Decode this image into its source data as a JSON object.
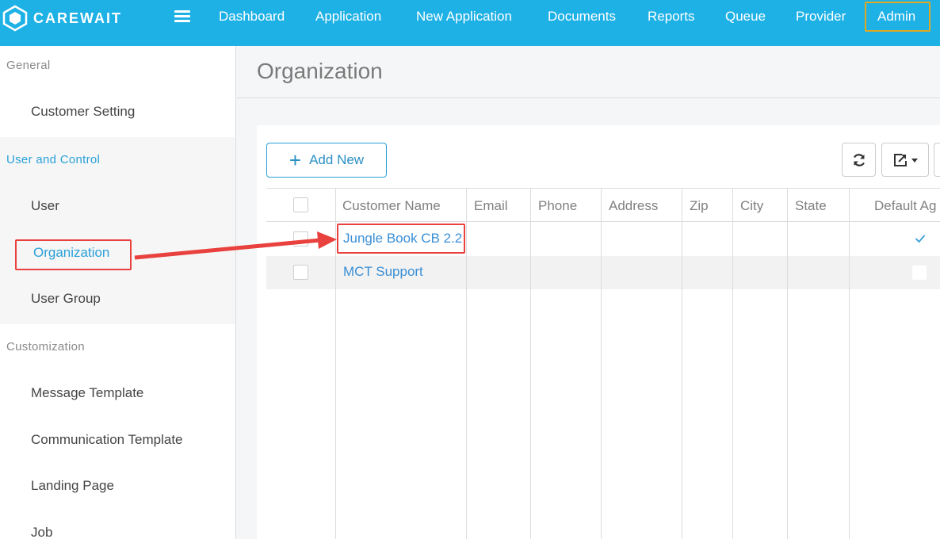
{
  "app": {
    "logo_text": "CAREWAIT"
  },
  "nav": {
    "items": [
      {
        "label": "Dashboard"
      },
      {
        "label": "Application"
      },
      {
        "label": "New Application"
      },
      {
        "label": "Documents"
      },
      {
        "label": "Reports"
      },
      {
        "label": "Queue"
      },
      {
        "label": "Provider"
      },
      {
        "label": "Admin"
      }
    ]
  },
  "sidebar": {
    "groups": [
      {
        "title": "General",
        "items": [
          "Customer Setting"
        ]
      },
      {
        "title": "User and Control",
        "items": [
          "User",
          "Organization",
          "User Group"
        ]
      },
      {
        "title": "Customization",
        "items": [
          "Message Template",
          "Communication Template",
          "Landing Page",
          "Job"
        ]
      }
    ]
  },
  "main": {
    "title": "Organization",
    "add_new_label": "Add New",
    "table": {
      "columns": [
        "Customer Name",
        "Email",
        "Phone",
        "Address",
        "Zip",
        "City",
        "State",
        "Default Ag"
      ],
      "rows": [
        {
          "customer_name": "Jungle Book CB 2.2",
          "default": true
        },
        {
          "customer_name": "MCT Support",
          "default": false
        }
      ]
    }
  },
  "colors": {
    "topbar": "#1eb1e6",
    "accent": "#2aa0d8",
    "highlight": "#e8413e",
    "admin_outline": "#e0a820"
  },
  "icons": [
    "logo-icon",
    "hamburger-icon",
    "plus-icon",
    "refresh-icon",
    "export-icon",
    "chevron-down-icon",
    "check-icon"
  ]
}
